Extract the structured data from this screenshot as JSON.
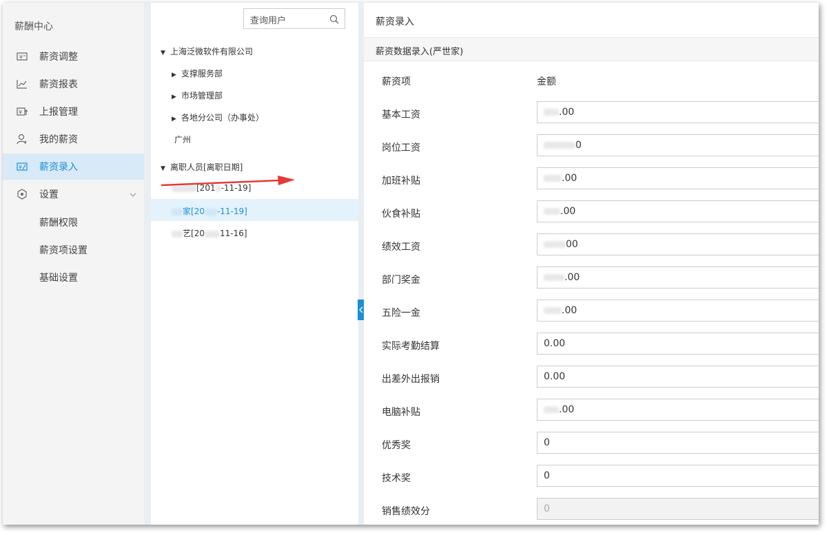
{
  "sidebar": {
    "brand": "薪酬中心",
    "items": [
      {
        "label": "薪资调整",
        "icon": "money-card-icon"
      },
      {
        "label": "薪资报表",
        "icon": "line-chart-icon"
      },
      {
        "label": "上报管理",
        "icon": "upload-report-icon"
      },
      {
        "label": "我的薪资",
        "icon": "user-icon"
      },
      {
        "label": "薪资录入",
        "icon": "salary-entry-icon"
      },
      {
        "label": "设置",
        "icon": "settings-icon"
      }
    ],
    "subitems": [
      "薪酬权限",
      "薪资项设置",
      "基础设置"
    ]
  },
  "tree": {
    "search_placeholder": "查询用户",
    "company": "上海泛微软件有限公司",
    "depts": [
      "支撑服务部",
      "市场管理部",
      "各地分公司（办事处）"
    ],
    "city": "广州",
    "departed_header": "离职人员[离职日期]",
    "departed": [
      {
        "prefix": "",
        "suffix": "[201",
        "date": "-11-19]"
      },
      {
        "prefix": "家",
        "suffix": "[20",
        "date": "-11-19]"
      },
      {
        "prefix": "艺",
        "suffix": "[20",
        "date": "11-16]"
      }
    ]
  },
  "main": {
    "title": "薪资录入",
    "subtitle": "薪资数据录入(严世家)",
    "col_item": "薪资项",
    "col_amount": "金额",
    "rows": [
      {
        "label": "基本工资",
        "value": ".00",
        "disabled": false
      },
      {
        "label": "岗位工资",
        "value": "0",
        "disabled": false
      },
      {
        "label": "加班补贴",
        "value": ".00",
        "disabled": false
      },
      {
        "label": "伙食补贴",
        "value": ".00",
        "disabled": false
      },
      {
        "label": "绩效工资",
        "value": "00",
        "disabled": false
      },
      {
        "label": "部门奖金",
        "value": ".00",
        "disabled": false
      },
      {
        "label": "五险一金",
        "value": ".00",
        "disabled": false
      },
      {
        "label": "实际考勤结算",
        "value": "0.00",
        "disabled": false
      },
      {
        "label": "出差外出报销",
        "value": "0.00",
        "disabled": false
      },
      {
        "label": "电脑补贴",
        "value": ".00",
        "disabled": false
      },
      {
        "label": "优秀奖",
        "value": "0",
        "disabled": false
      },
      {
        "label": "技术奖",
        "value": "0",
        "disabled": false
      },
      {
        "label": "销售绩效分",
        "value": "0",
        "disabled": true
      }
    ]
  },
  "colors": {
    "accent": "#1a8fd8",
    "arrow": "#e53935"
  }
}
